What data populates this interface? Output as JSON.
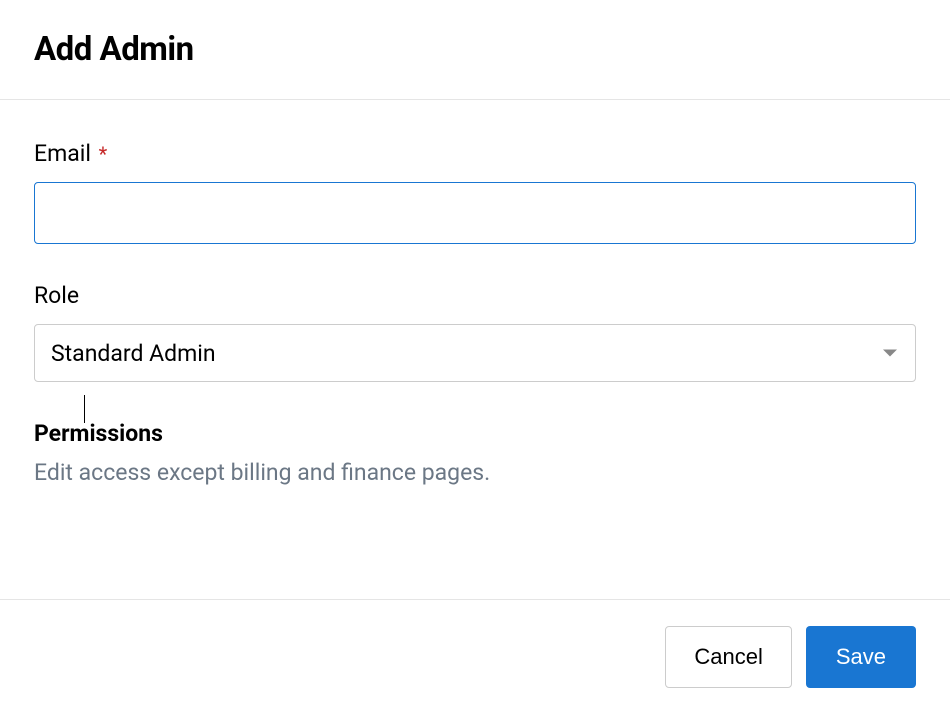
{
  "header": {
    "title": "Add Admin"
  },
  "form": {
    "email": {
      "label": "Email",
      "required_marker": "*",
      "value": ""
    },
    "role": {
      "label": "Role",
      "selected": "Standard Admin"
    },
    "permissions": {
      "heading": "Permissions",
      "description": "Edit access except billing and finance pages."
    }
  },
  "footer": {
    "cancel_label": "Cancel",
    "save_label": "Save"
  }
}
